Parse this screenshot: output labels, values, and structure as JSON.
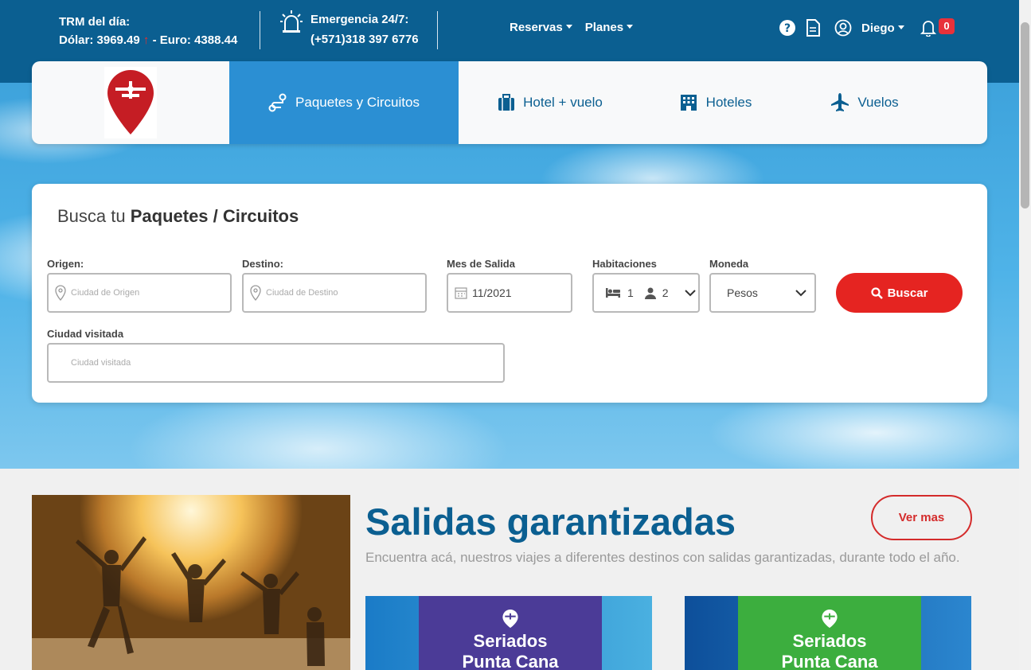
{
  "topbar": {
    "trm_title": "TRM del día:",
    "dolar": "Dólar: 3969.49",
    "up_arrow": "↑",
    "euro": "- Euro: 4388.44",
    "emergency_title": "Emergencia 24/7:",
    "emergency_phone": "(+571)318 397 6776",
    "nav": [
      "Reservas",
      "Planes"
    ],
    "user_name": "Diego",
    "notifications": "0"
  },
  "tabs": [
    {
      "label": "Paquetes y Circuitos",
      "icon": "route-icon",
      "active": true
    },
    {
      "label": "Hotel + vuelo",
      "icon": "suitcase-icon",
      "active": false
    },
    {
      "label": "Hoteles",
      "icon": "hotel-icon",
      "active": false
    },
    {
      "label": "Vuelos",
      "icon": "plane-icon",
      "active": false
    }
  ],
  "search": {
    "title_prefix": "Busca tu ",
    "title_bold": "Paquetes / Circuitos",
    "origen_label": "Origen:",
    "origen_placeholder": "Ciudad de Origen",
    "destino_label": "Destino:",
    "destino_placeholder": "Ciudad de Destino",
    "mes_label": "Mes de Salida",
    "mes_value": "11/2021",
    "hab_label": "Habitaciones",
    "hab_rooms": "1",
    "hab_people": "2",
    "moneda_label": "Moneda",
    "moneda_value": "Pesos",
    "buscar_label": "Buscar",
    "ciudad_label": "Ciudad visitada",
    "ciudad_placeholder": "Ciudad visitada"
  },
  "section": {
    "title": "Salidas garantizadas",
    "ver_mas": "Ver mas",
    "description": "Encuentra acá, nuestros viajes a diferentes destinos con salidas garantizadas, durante todo el año.",
    "cards": [
      {
        "title_line1": "Seriados",
        "title_line2": "Punta Cana",
        "color": "#4b3b97"
      },
      {
        "title_line1": "Seriados",
        "title_line2": "Punta Cana",
        "color": "#3cae3e"
      }
    ]
  }
}
